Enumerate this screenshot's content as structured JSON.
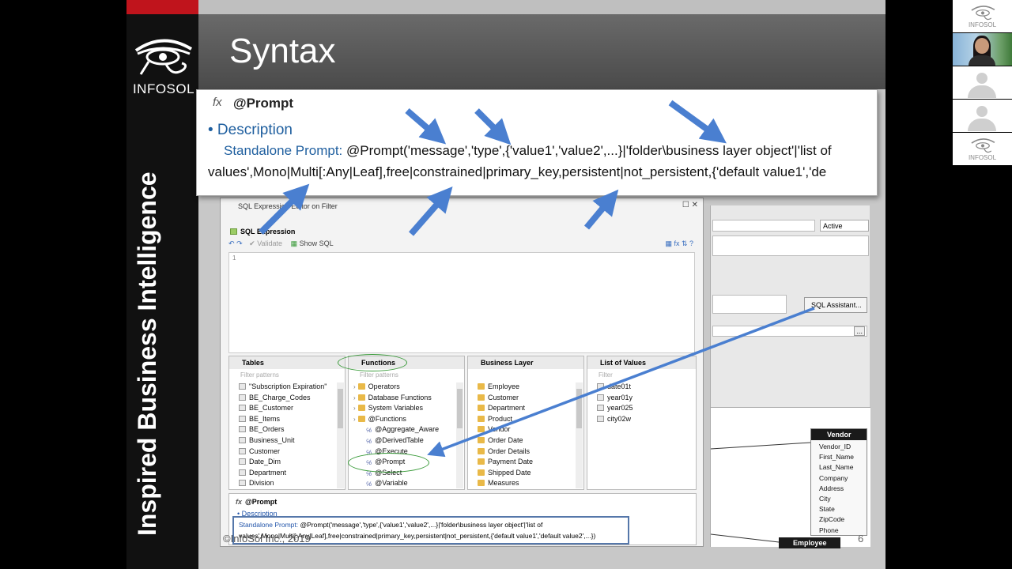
{
  "slide": {
    "title": "Syntax",
    "logo_text": "INFOSOL",
    "vertical_tagline": "Inspired Business Intelligence",
    "copyright": "©InfoSol Inc., 2019",
    "page_number": "6"
  },
  "callout": {
    "fx": "fx",
    "title": "@Prompt",
    "bullet": "• Description",
    "label": "Standalone Prompt:",
    "line1_text": " @Prompt('message','type',{'value1','value2',...}|'folder\\business layer object'|'list of",
    "line2_text": "values',Mono|Multi[:Any|Leaf],free|constrained|primary_key,persistent|not_persistent,{'default value1','de"
  },
  "sql_window": {
    "title": "SQL Expression Editor on Filter",
    "controls": "☐   ✕",
    "section_label": "SQL Expression",
    "validate_label": "Validate",
    "show_sql_label": "Show SQL",
    "line_number": "1"
  },
  "panels": {
    "tables": {
      "header": "Tables",
      "filter_placeholder": "Filter patterns",
      "items": [
        "\"Subscription Expiration\"",
        "BE_Charge_Codes",
        "BE_Customer",
        "BE_Items",
        "BE_Orders",
        "Business_Unit",
        "Customer",
        "Date_Dim",
        "Department",
        "Division"
      ]
    },
    "functions": {
      "header": "Functions",
      "filter_placeholder": "Filter patterns",
      "items": [
        {
          "label": "Operators",
          "kind": "folder",
          "indent": 0
        },
        {
          "label": "Database Functions",
          "kind": "folder",
          "indent": 0
        },
        {
          "label": "System Variables",
          "kind": "folder",
          "indent": 0
        },
        {
          "label": "@Functions",
          "kind": "folder",
          "indent": 0
        },
        {
          "label": "@Aggregate_Aware",
          "kind": "fn",
          "indent": 1
        },
        {
          "label": "@DerivedTable",
          "kind": "fn",
          "indent": 1
        },
        {
          "label": "@Execute",
          "kind": "fn",
          "indent": 1
        },
        {
          "label": "@Prompt",
          "kind": "fn",
          "indent": 1
        },
        {
          "label": "@Select",
          "kind": "fn",
          "indent": 1
        },
        {
          "label": "@Variable",
          "kind": "fn",
          "indent": 1
        }
      ]
    },
    "business_layer": {
      "header": "Business Layer",
      "items": [
        "Employee",
        "Customer",
        "Department",
        "Product",
        "Vendor",
        "Order Date",
        "Order Details",
        "Payment Date",
        "Shipped Date",
        "Measures"
      ]
    },
    "list_of_values": {
      "header": "List of Values",
      "filter_placeholder": "Filter",
      "items": [
        "date01t",
        "year01y",
        "year025",
        "city02w"
      ]
    }
  },
  "bottom_help": {
    "title": "@Prompt",
    "desc": "• Description",
    "label": "Standalone Prompt:",
    "line1_text": " @Prompt('message','type',{'value1','value2',...}|'folder\\business layer object'|'list of",
    "line2_text": "values',Mono|Multi[:Any|Leaf],free|constrained|primary_key,persistent|not_persistent,{'default value1','default value2',...})"
  },
  "right_app": {
    "active_select": "Active",
    "sql_assistant": "SQL Assistant...",
    "ellipsis_button": "...",
    "vendor_table": {
      "header": "Vendor",
      "columns": [
        "Vendor_ID",
        "First_Name",
        "Last_Name",
        "Company",
        "Address",
        "City",
        "State",
        "ZipCode",
        "Phone"
      ]
    },
    "employee_table": "Employee"
  },
  "participants": {
    "tile_label": "INFOSOL"
  },
  "colors": {
    "brand_red": "#c0141c",
    "arrow_blue": "#4a7fd0",
    "highlight_green": "#3a9b3a",
    "description_blue": "#1f5f9f"
  }
}
